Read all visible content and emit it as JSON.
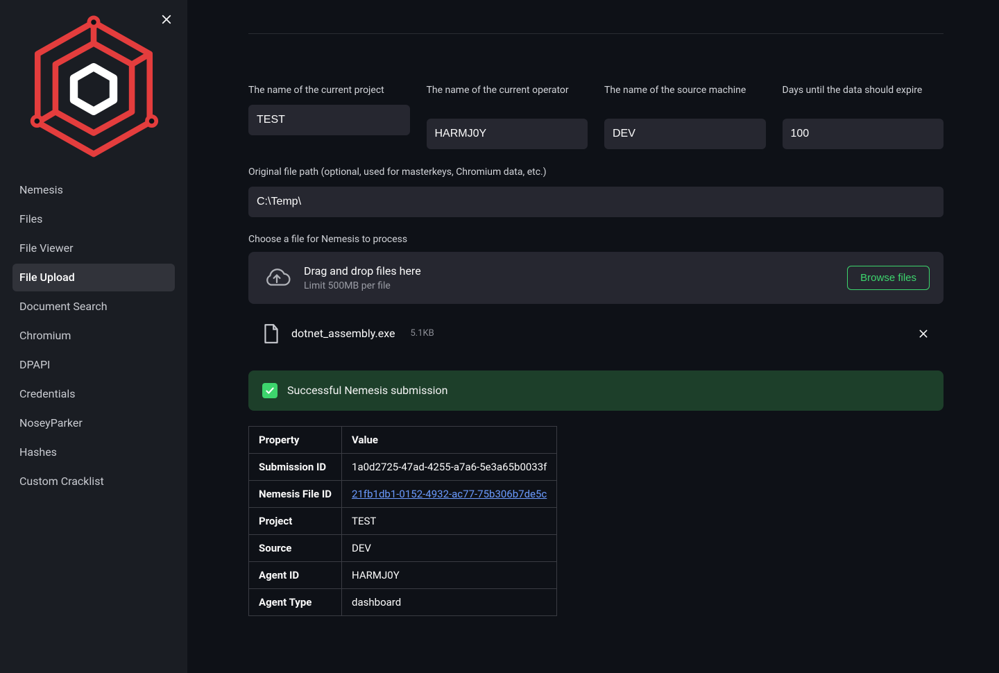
{
  "sidebar": {
    "items": [
      "Nemesis",
      "Files",
      "File Viewer",
      "File Upload",
      "Document Search",
      "Chromium",
      "DPAPI",
      "Credentials",
      "NoseyParker",
      "Hashes",
      "Custom Cracklist"
    ],
    "active_index": 3
  },
  "form": {
    "project_label": "The name of the current project",
    "project_value": "TEST",
    "operator_label": "The name of the current operator",
    "operator_value": "HARMJ0Y",
    "source_label": "The name of the source machine",
    "source_value": "DEV",
    "expire_label": "Days until the data should expire",
    "expire_value": "100",
    "origpath_label": "Original file path (optional, used for masterkeys, Chromium data, etc.)",
    "origpath_value": "C:\\Temp\\",
    "chooser_label": "Choose a file for Nemesis to process",
    "drop_main": "Drag and drop files here",
    "drop_sub": "Limit 500MB per file",
    "browse_label": "Browse files"
  },
  "uploaded_file": {
    "name": "dotnet_assembly.exe",
    "size": "5.1KB"
  },
  "success_msg": "Successful Nemesis submission",
  "result": {
    "headers": {
      "property": "Property",
      "value": "Value"
    },
    "rows": [
      {
        "k": "Submission ID",
        "v": "1a0d2725-47ad-4255-a7a6-5e3a65b0033f",
        "link": false
      },
      {
        "k": "Nemesis File ID",
        "v": "21fb1db1-0152-4932-ac77-75b306b7de5c",
        "link": true
      },
      {
        "k": "Project",
        "v": "TEST",
        "link": false
      },
      {
        "k": "Source",
        "v": "DEV",
        "link": false
      },
      {
        "k": "Agent ID",
        "v": "HARMJ0Y",
        "link": false
      },
      {
        "k": "Agent Type",
        "v": "dashboard",
        "link": false
      }
    ]
  }
}
